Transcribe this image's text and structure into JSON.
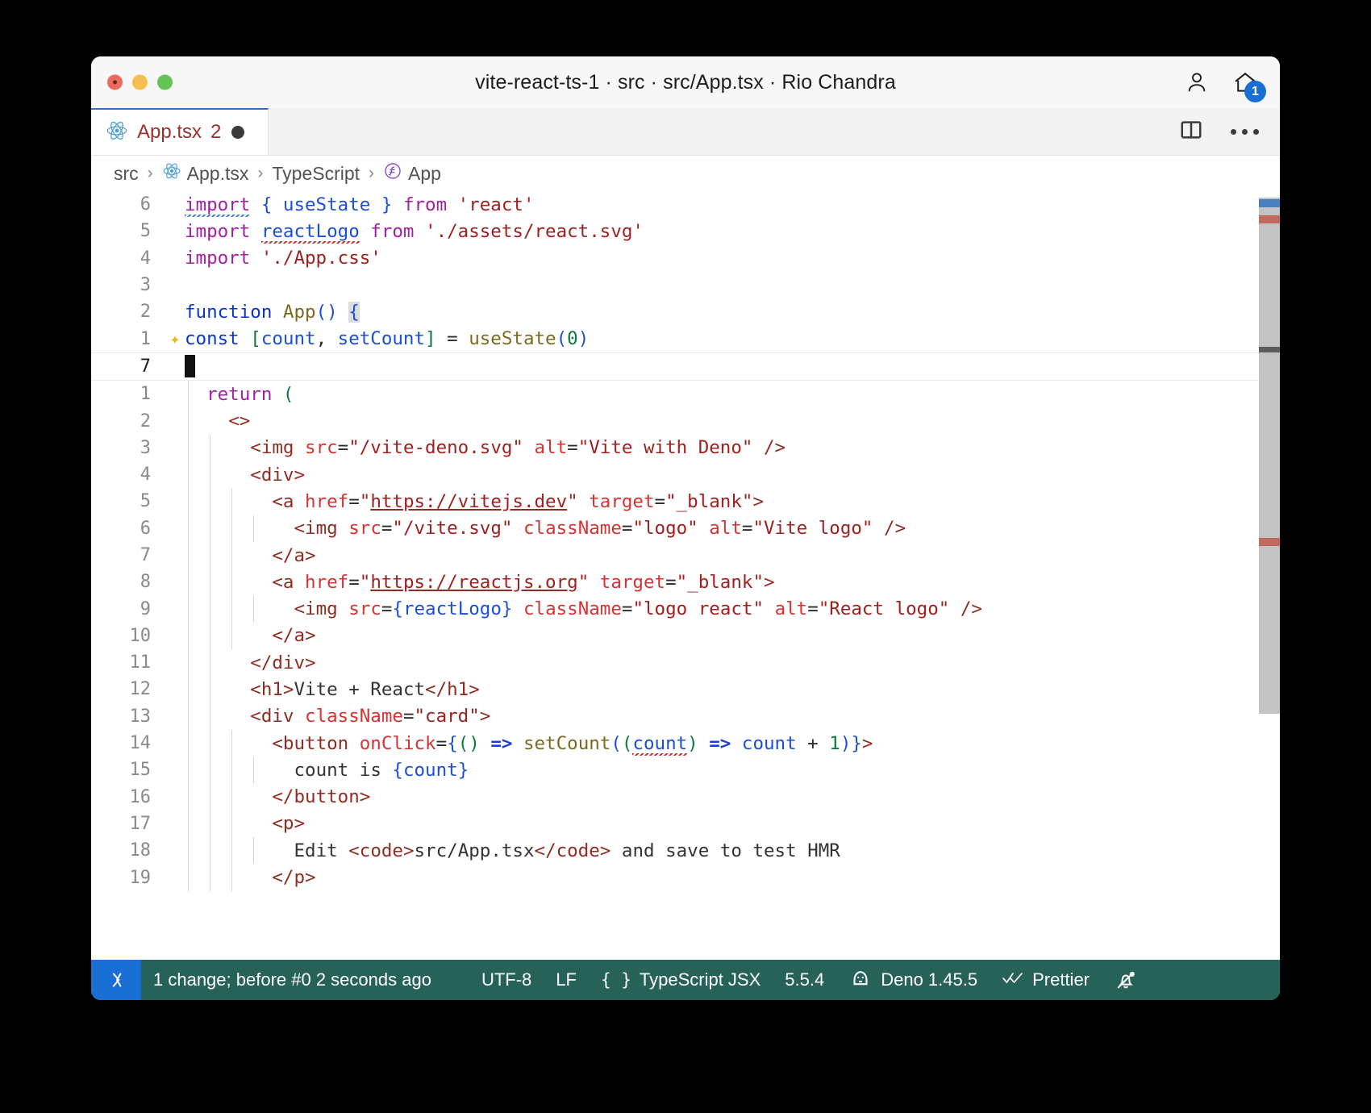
{
  "window": {
    "title": "vite-react-ts-1 · src · src/App.tsx · Rio Chandra",
    "traffic_icons": [
      "close-icon",
      "minimize-icon",
      "maximize-icon"
    ],
    "right_icons": [
      {
        "name": "account-icon",
        "label": "Accounts"
      },
      {
        "name": "home-icon",
        "label": "Home",
        "badge": "1"
      }
    ]
  },
  "tabs": [
    {
      "icon": "react-icon",
      "label": "App.tsx",
      "count": "2",
      "dirty": true
    }
  ],
  "tabbar_actions": [
    {
      "name": "split-editor-icon",
      "label": "Split Editor"
    },
    {
      "name": "more-actions-icon",
      "label": "More Actions..."
    }
  ],
  "breadcrumb": [
    {
      "label": "src",
      "icon": null
    },
    {
      "label": "App.tsx",
      "icon": "react-icon"
    },
    {
      "label": "TypeScript",
      "icon": null
    },
    {
      "label": "App",
      "icon": "function-symbol-icon"
    }
  ],
  "breadcrumb_separator": "›",
  "editor": {
    "language": "TypeScript JSX",
    "cursor_line": 7,
    "lines": [
      {
        "num": "6",
        "indent": 0,
        "guides": 0,
        "sparkle": false,
        "current": false,
        "tokens": [
          {
            "t": "import",
            "c": "t-kw sq-blue"
          },
          {
            "t": " ",
            "c": "t-plain"
          },
          {
            "t": "{",
            "c": "t-b1"
          },
          {
            "t": " ",
            "c": "t-plain"
          },
          {
            "t": "useState",
            "c": "t-var"
          },
          {
            "t": " ",
            "c": "t-plain"
          },
          {
            "t": "}",
            "c": "t-b1"
          },
          {
            "t": " ",
            "c": "t-plain"
          },
          {
            "t": "from",
            "c": "t-kw"
          },
          {
            "t": " ",
            "c": "t-plain"
          },
          {
            "t": "'react'",
            "c": "t-str"
          }
        ]
      },
      {
        "num": "5",
        "indent": 0,
        "guides": 0,
        "sparkle": false,
        "current": false,
        "tokens": [
          {
            "t": "import",
            "c": "t-kw"
          },
          {
            "t": " ",
            "c": "t-plain"
          },
          {
            "t": "reactLogo",
            "c": "t-var sq-red"
          },
          {
            "t": " ",
            "c": "t-plain"
          },
          {
            "t": "from",
            "c": "t-kw"
          },
          {
            "t": " ",
            "c": "t-plain"
          },
          {
            "t": "'./assets/react.svg'",
            "c": "t-str"
          }
        ]
      },
      {
        "num": "4",
        "indent": 0,
        "guides": 0,
        "sparkle": false,
        "current": false,
        "tokens": [
          {
            "t": "import",
            "c": "t-kw"
          },
          {
            "t": " ",
            "c": "t-plain"
          },
          {
            "t": "'./App.css'",
            "c": "t-str"
          }
        ]
      },
      {
        "num": "3",
        "indent": 0,
        "guides": 0,
        "sparkle": false,
        "current": false,
        "tokens": []
      },
      {
        "num": "2",
        "indent": 0,
        "guides": 0,
        "sparkle": false,
        "current": false,
        "tokens": [
          {
            "t": "function",
            "c": "t-kw2"
          },
          {
            "t": " ",
            "c": "t-plain"
          },
          {
            "t": "App",
            "c": "t-fn"
          },
          {
            "t": "()",
            "c": "t-b1"
          },
          {
            "t": " ",
            "c": "t-plain"
          },
          {
            "t": "{",
            "c": "t-b1 brace-hl"
          }
        ]
      },
      {
        "num": "1",
        "indent": 0,
        "guides": 0,
        "sparkle": true,
        "current": false,
        "tokens": [
          {
            "t": "const",
            "c": "t-kw2"
          },
          {
            "t": " ",
            "c": "t-plain"
          },
          {
            "t": "[",
            "c": "t-b2"
          },
          {
            "t": "count",
            "c": "t-var"
          },
          {
            "t": ", ",
            "c": "t-plain"
          },
          {
            "t": "setCount",
            "c": "t-var"
          },
          {
            "t": "]",
            "c": "t-b2"
          },
          {
            "t": " = ",
            "c": "t-plain"
          },
          {
            "t": "useState",
            "c": "t-fn"
          },
          {
            "t": "(",
            "c": "t-b1"
          },
          {
            "t": "0",
            "c": "t-num"
          },
          {
            "t": ")",
            "c": "t-b1"
          }
        ]
      },
      {
        "num": "7",
        "indent": 0,
        "guides": 0,
        "sparkle": false,
        "current": true,
        "cursor": true,
        "tokens": []
      },
      {
        "num": "1",
        "indent": 1,
        "guides": 1,
        "sparkle": false,
        "current": false,
        "tokens": [
          {
            "t": "return",
            "c": "t-kw"
          },
          {
            "t": " ",
            "c": "t-plain"
          },
          {
            "t": "(",
            "c": "t-b2"
          }
        ]
      },
      {
        "num": "2",
        "indent": 2,
        "guides": 1,
        "sparkle": false,
        "current": false,
        "tokens": [
          {
            "t": "<>",
            "c": "t-tag"
          }
        ]
      },
      {
        "num": "3",
        "indent": 3,
        "guides": 2,
        "sparkle": false,
        "current": false,
        "tokens": [
          {
            "t": "<img ",
            "c": "t-tag"
          },
          {
            "t": "src",
            "c": "t-attr"
          },
          {
            "t": "=",
            "c": "t-plain"
          },
          {
            "t": "\"/vite-deno.svg\"",
            "c": "t-str"
          },
          {
            "t": " ",
            "c": "t-plain"
          },
          {
            "t": "alt",
            "c": "t-attr"
          },
          {
            "t": "=",
            "c": "t-plain"
          },
          {
            "t": "\"Vite with Deno\"",
            "c": "t-str"
          },
          {
            "t": " />",
            "c": "t-tag"
          }
        ]
      },
      {
        "num": "4",
        "indent": 3,
        "guides": 2,
        "sparkle": false,
        "current": false,
        "tokens": [
          {
            "t": "<div>",
            "c": "t-tag"
          }
        ]
      },
      {
        "num": "5",
        "indent": 4,
        "guides": 3,
        "sparkle": false,
        "current": false,
        "tokens": [
          {
            "t": "<a ",
            "c": "t-tag"
          },
          {
            "t": "href",
            "c": "t-attr"
          },
          {
            "t": "=",
            "c": "t-plain"
          },
          {
            "t": "\"",
            "c": "t-str"
          },
          {
            "t": "https://vitejs.dev",
            "c": "t-str link"
          },
          {
            "t": "\"",
            "c": "t-str"
          },
          {
            "t": " ",
            "c": "t-plain"
          },
          {
            "t": "target",
            "c": "t-attr"
          },
          {
            "t": "=",
            "c": "t-plain"
          },
          {
            "t": "\"_blank\"",
            "c": "t-str"
          },
          {
            "t": ">",
            "c": "t-tag"
          }
        ]
      },
      {
        "num": "6",
        "indent": 5,
        "guides": 4,
        "sparkle": false,
        "current": false,
        "tokens": [
          {
            "t": "<img ",
            "c": "t-tag"
          },
          {
            "t": "src",
            "c": "t-attr"
          },
          {
            "t": "=",
            "c": "t-plain"
          },
          {
            "t": "\"/vite.svg\"",
            "c": "t-str"
          },
          {
            "t": " ",
            "c": "t-plain"
          },
          {
            "t": "className",
            "c": "t-attr"
          },
          {
            "t": "=",
            "c": "t-plain"
          },
          {
            "t": "\"logo\"",
            "c": "t-str"
          },
          {
            "t": " ",
            "c": "t-plain"
          },
          {
            "t": "alt",
            "c": "t-attr"
          },
          {
            "t": "=",
            "c": "t-plain"
          },
          {
            "t": "\"Vite logo\"",
            "c": "t-str"
          },
          {
            "t": " />",
            "c": "t-tag"
          }
        ]
      },
      {
        "num": "7",
        "indent": 4,
        "guides": 3,
        "sparkle": false,
        "current": false,
        "tokens": [
          {
            "t": "</a>",
            "c": "t-tag"
          }
        ]
      },
      {
        "num": "8",
        "indent": 4,
        "guides": 3,
        "sparkle": false,
        "current": false,
        "tokens": [
          {
            "t": "<a ",
            "c": "t-tag"
          },
          {
            "t": "href",
            "c": "t-attr"
          },
          {
            "t": "=",
            "c": "t-plain"
          },
          {
            "t": "\"",
            "c": "t-str"
          },
          {
            "t": "https://reactjs.org",
            "c": "t-str link"
          },
          {
            "t": "\"",
            "c": "t-str"
          },
          {
            "t": " ",
            "c": "t-plain"
          },
          {
            "t": "target",
            "c": "t-attr"
          },
          {
            "t": "=",
            "c": "t-plain"
          },
          {
            "t": "\"_blank\"",
            "c": "t-str"
          },
          {
            "t": ">",
            "c": "t-tag"
          }
        ]
      },
      {
        "num": "9",
        "indent": 5,
        "guides": 4,
        "sparkle": false,
        "current": false,
        "tokens": [
          {
            "t": "<img ",
            "c": "t-tag"
          },
          {
            "t": "src",
            "c": "t-attr"
          },
          {
            "t": "=",
            "c": "t-plain"
          },
          {
            "t": "{",
            "c": "t-b1"
          },
          {
            "t": "reactLogo",
            "c": "t-var"
          },
          {
            "t": "}",
            "c": "t-b1"
          },
          {
            "t": " ",
            "c": "t-plain"
          },
          {
            "t": "className",
            "c": "t-attr"
          },
          {
            "t": "=",
            "c": "t-plain"
          },
          {
            "t": "\"logo react\"",
            "c": "t-str"
          },
          {
            "t": " ",
            "c": "t-plain"
          },
          {
            "t": "alt",
            "c": "t-attr"
          },
          {
            "t": "=",
            "c": "t-plain"
          },
          {
            "t": "\"React logo\"",
            "c": "t-str"
          },
          {
            "t": " />",
            "c": "t-tag"
          }
        ]
      },
      {
        "num": "10",
        "indent": 4,
        "guides": 3,
        "sparkle": false,
        "current": false,
        "tokens": [
          {
            "t": "</a>",
            "c": "t-tag"
          }
        ]
      },
      {
        "num": "11",
        "indent": 3,
        "guides": 2,
        "sparkle": false,
        "current": false,
        "tokens": [
          {
            "t": "</div>",
            "c": "t-tag"
          }
        ]
      },
      {
        "num": "12",
        "indent": 3,
        "guides": 2,
        "sparkle": false,
        "current": false,
        "tokens": [
          {
            "t": "<h1>",
            "c": "t-tag"
          },
          {
            "t": "Vite + React",
            "c": "t-txt"
          },
          {
            "t": "</h1>",
            "c": "t-tag"
          }
        ]
      },
      {
        "num": "13",
        "indent": 3,
        "guides": 2,
        "sparkle": false,
        "current": false,
        "tokens": [
          {
            "t": "<div ",
            "c": "t-tag"
          },
          {
            "t": "className",
            "c": "t-attr"
          },
          {
            "t": "=",
            "c": "t-plain"
          },
          {
            "t": "\"card\"",
            "c": "t-str"
          },
          {
            "t": ">",
            "c": "t-tag"
          }
        ]
      },
      {
        "num": "14",
        "indent": 4,
        "guides": 3,
        "sparkle": false,
        "current": false,
        "tokens": [
          {
            "t": "<button ",
            "c": "t-tag"
          },
          {
            "t": "onClick",
            "c": "t-attr"
          },
          {
            "t": "=",
            "c": "t-plain"
          },
          {
            "t": "{",
            "c": "t-b1"
          },
          {
            "t": "()",
            "c": "t-b2"
          },
          {
            "t": " ",
            "c": "t-plain"
          },
          {
            "t": "=>",
            "c": "t-arrow"
          },
          {
            "t": " ",
            "c": "t-plain"
          },
          {
            "t": "setCount",
            "c": "t-fn"
          },
          {
            "t": "(",
            "c": "t-b1"
          },
          {
            "t": "(",
            "c": "t-b2"
          },
          {
            "t": "count",
            "c": "t-var sq-red"
          },
          {
            "t": ")",
            "c": "t-b2"
          },
          {
            "t": " ",
            "c": "t-plain"
          },
          {
            "t": "=>",
            "c": "t-arrow"
          },
          {
            "t": " ",
            "c": "t-plain"
          },
          {
            "t": "count",
            "c": "t-var"
          },
          {
            "t": " + ",
            "c": "t-plain"
          },
          {
            "t": "1",
            "c": "t-num"
          },
          {
            "t": ")",
            "c": "t-b1"
          },
          {
            "t": "}",
            "c": "t-b1"
          },
          {
            "t": ">",
            "c": "t-tag"
          }
        ]
      },
      {
        "num": "15",
        "indent": 5,
        "guides": 4,
        "sparkle": false,
        "current": false,
        "tokens": [
          {
            "t": "count is ",
            "c": "t-txt"
          },
          {
            "t": "{",
            "c": "t-b1"
          },
          {
            "t": "count",
            "c": "t-var"
          },
          {
            "t": "}",
            "c": "t-b1"
          }
        ]
      },
      {
        "num": "16",
        "indent": 4,
        "guides": 3,
        "sparkle": false,
        "current": false,
        "tokens": [
          {
            "t": "</button>",
            "c": "t-tag"
          }
        ]
      },
      {
        "num": "17",
        "indent": 4,
        "guides": 3,
        "sparkle": false,
        "current": false,
        "tokens": [
          {
            "t": "<p>",
            "c": "t-tag"
          }
        ]
      },
      {
        "num": "18",
        "indent": 5,
        "guides": 4,
        "sparkle": false,
        "current": false,
        "tokens": [
          {
            "t": "Edit ",
            "c": "t-txt"
          },
          {
            "t": "<code>",
            "c": "t-tag"
          },
          {
            "t": "src/App.tsx",
            "c": "t-txt"
          },
          {
            "t": "</code>",
            "c": "t-tag"
          },
          {
            "t": " and save to test HMR",
            "c": "t-txt"
          }
        ]
      },
      {
        "num": "19",
        "indent": 4,
        "guides": 3,
        "sparkle": false,
        "current": false,
        "tokens": [
          {
            "t": "</p>",
            "c": "t-tag"
          }
        ]
      }
    ]
  },
  "statusbar": {
    "remote_icon": "remote-window-icon",
    "items": [
      {
        "name": "timeline-status",
        "label": "1 change; before #0  2 seconds ago",
        "icon": null
      },
      {
        "name": "encoding-status",
        "label": "UTF-8",
        "icon": null
      },
      {
        "name": "eol-status",
        "label": "LF",
        "icon": null
      },
      {
        "name": "language-status",
        "label": "TypeScript JSX",
        "icon": "braces-icon"
      },
      {
        "name": "ts-version-status",
        "label": "5.5.4",
        "icon": null
      },
      {
        "name": "deno-status",
        "label": "Deno 1.45.5",
        "icon": "deno-icon"
      },
      {
        "name": "prettier-status",
        "label": "Prettier",
        "icon": "check-all-icon"
      }
    ],
    "notifications_icon": "bell-slash-icon"
  },
  "colors": {
    "accent": "#1a6fd4",
    "statusbar_bg": "#276259",
    "tab_active_border": "#2a6fd4",
    "badge": "#1a6fd4"
  }
}
